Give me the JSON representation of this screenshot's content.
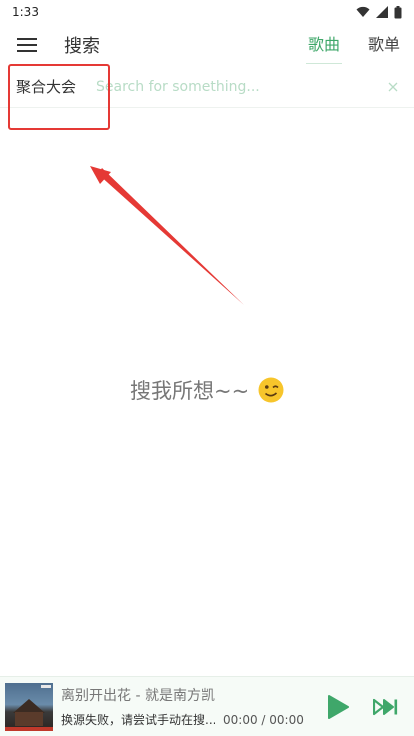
{
  "status_bar": {
    "time": "1:33",
    "icons": [
      "wifi-icon",
      "signal-icon",
      "battery-icon"
    ]
  },
  "header": {
    "menu_icon": "hamburger-menu-icon",
    "title": "搜索",
    "tabs": [
      {
        "label": "歌曲",
        "active": true
      },
      {
        "label": "歌单",
        "active": false
      }
    ]
  },
  "search": {
    "source": "聚合大会",
    "placeholder": "Search for something...",
    "value": "",
    "clear_icon": "close-icon"
  },
  "empty_state": {
    "text": "搜我所想~~",
    "emoji": "wink-emoji"
  },
  "player": {
    "title": "离别开出花 - 就是南方凯",
    "status": "换源失败，请尝试手动在搜...",
    "time": "00:00 / 00:00",
    "play_icon": "play-icon",
    "next_icon": "skip-next-icon"
  },
  "colors": {
    "accent": "#3fa76a",
    "annotation": "#e53935",
    "placeholder": "#b8dcc6"
  }
}
